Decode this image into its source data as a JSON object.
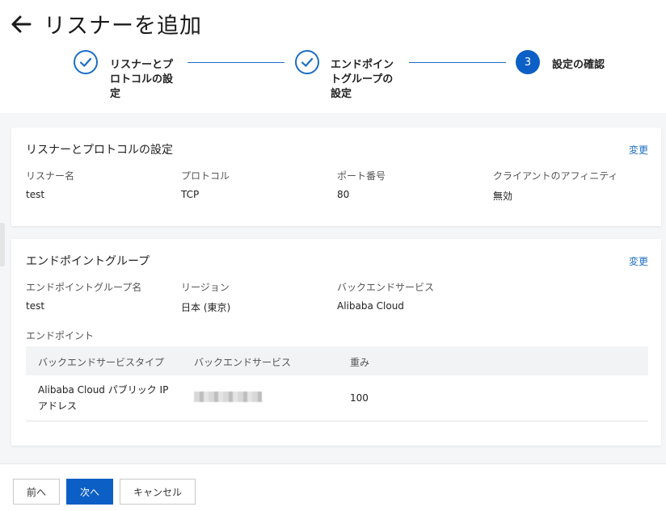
{
  "header": {
    "title": "リスナーを追加"
  },
  "steps": [
    {
      "label_lines": [
        "リスナーとプ",
        "ロトコルの設",
        "定"
      ],
      "status": "done"
    },
    {
      "label_lines": [
        "エンドポイン",
        "トグループの",
        "設定"
      ],
      "status": "done"
    },
    {
      "number": "3",
      "label_lines": [
        "設定の確認"
      ],
      "status": "current"
    }
  ],
  "listener_card": {
    "title": "リスナーとプロトコルの設定",
    "edit_label": "変更",
    "fields": [
      {
        "label": "リスナー名",
        "value": "test"
      },
      {
        "label": "プロトコル",
        "value": "TCP"
      },
      {
        "label": "ポート番号",
        "value": "80"
      },
      {
        "label": "クライアントのアフィニティ",
        "value": "無効"
      }
    ]
  },
  "endpoint_card": {
    "title": "エンドポイントグループ",
    "edit_label": "変更",
    "fields": [
      {
        "label": "エンドポイントグループ名",
        "value": "test"
      },
      {
        "label": "リージョン",
        "value": "日本 (東京)"
      },
      {
        "label": "バックエンドサービス",
        "value": "Alibaba Cloud"
      }
    ],
    "endpoints_label": "エンドポイント",
    "table": {
      "columns": [
        "バックエンドサービスタイプ",
        "バックエンドサービス",
        "重み"
      ],
      "rows": [
        {
          "type_lines": [
            "Alibaba Cloud パブリック IP",
            "アドレス"
          ],
          "weight": "100"
        }
      ]
    }
  },
  "footer": {
    "prev_label": "前へ",
    "next_label": "次へ",
    "cancel_label": "キャンセル"
  },
  "colors": {
    "primary": "#0c5fc4",
    "link": "#1a6dc4"
  }
}
